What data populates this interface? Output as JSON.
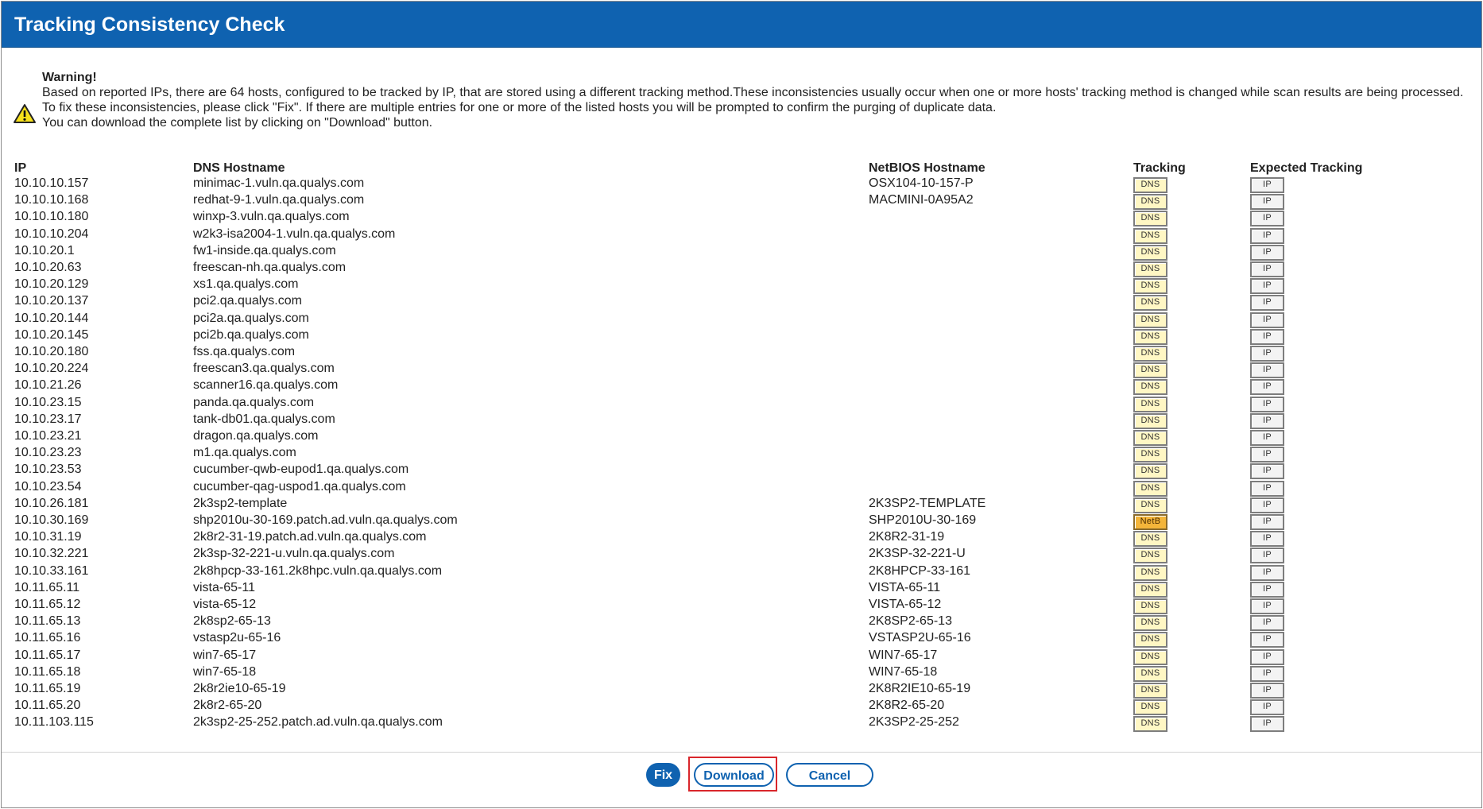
{
  "dialog": {
    "title": "Tracking Consistency Check"
  },
  "warning": {
    "title": "Warning!",
    "lines": [
      "Based on reported IPs, there are 64 hosts, configured to be tracked by IP, that are stored using a different tracking method.These inconsistencies usually occur when one or more hosts' tracking method is changed while scan results are being processed.",
      "To fix these inconsistencies, please click \"Fix\". If there are multiple entries for one or more of the listed hosts you will be prompted to confirm the purging of duplicate data.",
      "You can download the complete list by clicking on \"Download\" button."
    ],
    "icon": "warning-icon"
  },
  "table": {
    "headers": {
      "ip": "IP",
      "dns": "DNS Hostname",
      "netbios": "NetBIOS Hostname",
      "tracking": "Tracking",
      "expected": "Expected Tracking"
    },
    "rows": [
      {
        "ip": "10.10.10.157",
        "dns": "minimac-1.vuln.qa.qualys.com",
        "netbios": "OSX104-10-157-P",
        "tracking": "DNS",
        "expected": "IP"
      },
      {
        "ip": "10.10.10.168",
        "dns": "redhat-9-1.vuln.qa.qualys.com",
        "netbios": "MACMINI-0A95A2",
        "tracking": "DNS",
        "expected": "IP"
      },
      {
        "ip": "10.10.10.180",
        "dns": "winxp-3.vuln.qa.qualys.com",
        "netbios": "",
        "tracking": "DNS",
        "expected": "IP"
      },
      {
        "ip": "10.10.10.204",
        "dns": "w2k3-isa2004-1.vuln.qa.qualys.com",
        "netbios": "",
        "tracking": "DNS",
        "expected": "IP"
      },
      {
        "ip": "10.10.20.1",
        "dns": "fw1-inside.qa.qualys.com",
        "netbios": "",
        "tracking": "DNS",
        "expected": "IP"
      },
      {
        "ip": "10.10.20.63",
        "dns": "freescan-nh.qa.qualys.com",
        "netbios": "",
        "tracking": "DNS",
        "expected": "IP"
      },
      {
        "ip": "10.10.20.129",
        "dns": "xs1.qa.qualys.com",
        "netbios": "",
        "tracking": "DNS",
        "expected": "IP"
      },
      {
        "ip": "10.10.20.137",
        "dns": "pci2.qa.qualys.com",
        "netbios": "",
        "tracking": "DNS",
        "expected": "IP"
      },
      {
        "ip": "10.10.20.144",
        "dns": "pci2a.qa.qualys.com",
        "netbios": "",
        "tracking": "DNS",
        "expected": "IP"
      },
      {
        "ip": "10.10.20.145",
        "dns": "pci2b.qa.qualys.com",
        "netbios": "",
        "tracking": "DNS",
        "expected": "IP"
      },
      {
        "ip": "10.10.20.180",
        "dns": "fss.qa.qualys.com",
        "netbios": "",
        "tracking": "DNS",
        "expected": "IP"
      },
      {
        "ip": "10.10.20.224",
        "dns": "freescan3.qa.qualys.com",
        "netbios": "",
        "tracking": "DNS",
        "expected": "IP"
      },
      {
        "ip": "10.10.21.26",
        "dns": "scanner16.qa.qualys.com",
        "netbios": "",
        "tracking": "DNS",
        "expected": "IP"
      },
      {
        "ip": "10.10.23.15",
        "dns": "panda.qa.qualys.com",
        "netbios": "",
        "tracking": "DNS",
        "expected": "IP"
      },
      {
        "ip": "10.10.23.17",
        "dns": "tank-db01.qa.qualys.com",
        "netbios": "",
        "tracking": "DNS",
        "expected": "IP"
      },
      {
        "ip": "10.10.23.21",
        "dns": "dragon.qa.qualys.com",
        "netbios": "",
        "tracking": "DNS",
        "expected": "IP"
      },
      {
        "ip": "10.10.23.23",
        "dns": "m1.qa.qualys.com",
        "netbios": "",
        "tracking": "DNS",
        "expected": "IP"
      },
      {
        "ip": "10.10.23.53",
        "dns": "cucumber-qwb-eupod1.qa.qualys.com",
        "netbios": "",
        "tracking": "DNS",
        "expected": "IP"
      },
      {
        "ip": "10.10.23.54",
        "dns": "cucumber-qag-uspod1.qa.qualys.com",
        "netbios": "",
        "tracking": "DNS",
        "expected": "IP"
      },
      {
        "ip": "10.10.26.181",
        "dns": "2k3sp2-template",
        "netbios": "2K3SP2-TEMPLATE",
        "tracking": "DNS",
        "expected": "IP"
      },
      {
        "ip": "10.10.30.169",
        "dns": "shp2010u-30-169.patch.ad.vuln.qa.qualys.com",
        "netbios": "SHP2010U-30-169",
        "tracking": "NetB",
        "expected": "IP"
      },
      {
        "ip": "10.10.31.19",
        "dns": "2k8r2-31-19.patch.ad.vuln.qa.qualys.com",
        "netbios": "2K8R2-31-19",
        "tracking": "DNS",
        "expected": "IP"
      },
      {
        "ip": "10.10.32.221",
        "dns": "2k3sp-32-221-u.vuln.qa.qualys.com",
        "netbios": "2K3SP-32-221-U",
        "tracking": "DNS",
        "expected": "IP"
      },
      {
        "ip": "10.10.33.161",
        "dns": "2k8hpcp-33-161.2k8hpc.vuln.qa.qualys.com",
        "netbios": "2K8HPCP-33-161",
        "tracking": "DNS",
        "expected": "IP"
      },
      {
        "ip": "10.11.65.11",
        "dns": "vista-65-11",
        "netbios": "VISTA-65-11",
        "tracking": "DNS",
        "expected": "IP"
      },
      {
        "ip": "10.11.65.12",
        "dns": "vista-65-12",
        "netbios": "VISTA-65-12",
        "tracking": "DNS",
        "expected": "IP"
      },
      {
        "ip": "10.11.65.13",
        "dns": "2k8sp2-65-13",
        "netbios": "2K8SP2-65-13",
        "tracking": "DNS",
        "expected": "IP"
      },
      {
        "ip": "10.11.65.16",
        "dns": "vstasp2u-65-16",
        "netbios": "VSTASP2U-65-16",
        "tracking": "DNS",
        "expected": "IP"
      },
      {
        "ip": "10.11.65.17",
        "dns": "win7-65-17",
        "netbios": "WIN7-65-17",
        "tracking": "DNS",
        "expected": "IP"
      },
      {
        "ip": "10.11.65.18",
        "dns": "win7-65-18",
        "netbios": "WIN7-65-18",
        "tracking": "DNS",
        "expected": "IP"
      },
      {
        "ip": "10.11.65.19",
        "dns": "2k8r2ie10-65-19",
        "netbios": "2K8R2IE10-65-19",
        "tracking": "DNS",
        "expected": "IP"
      },
      {
        "ip": "10.11.65.20",
        "dns": "2k8r2-65-20",
        "netbios": "2K8R2-65-20",
        "tracking": "DNS",
        "expected": "IP"
      },
      {
        "ip": "10.11.103.115",
        "dns": "2k3sp2-25-252.patch.ad.vuln.qa.qualys.com",
        "netbios": "2K3SP2-25-252",
        "tracking": "DNS",
        "expected": "IP"
      }
    ]
  },
  "footer": {
    "fix_label": "Fix",
    "download_label": "Download",
    "cancel_label": "Cancel"
  },
  "colors": {
    "title_bar": "#0f62b0",
    "dns_badge": "#fff7c4",
    "netb_badge": "#f4b53a",
    "highlight": "#d9262b"
  }
}
